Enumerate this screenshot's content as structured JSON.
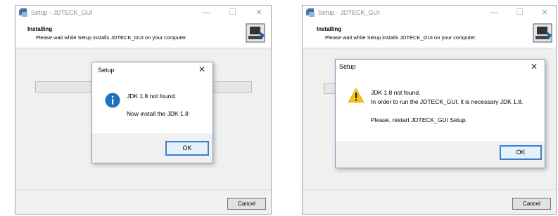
{
  "left_window": {
    "title": "Setup - JDTECK_GUI",
    "header_title": "Installing",
    "header_subtitle": "Please wait while Setup installs JDTECK_GUI on your computer.",
    "cancel_label": "Cancel",
    "dialog": {
      "title": "Setup",
      "line1": "JDK 1.8 not found.",
      "line2": "Now install the JDK 1.8",
      "ok_label": "OK",
      "icon": "info-icon"
    }
  },
  "right_window": {
    "title": "Setup - JDTECK_GUI",
    "header_title": "Installing",
    "header_subtitle": "Please wait while Setup installs JDTECK_GUI on your computer.",
    "cancel_label": "Cancel",
    "dialog": {
      "title": "Setup",
      "line1": "JDK 1.8 not found.",
      "line2": "In order to run the JDTECK_GUI, it is necessary JDK 1.8.",
      "line3": "Please, restart JDTECK_GUI Setup.",
      "ok_label": "OK",
      "icon": "warning-icon"
    }
  },
  "colors": {
    "accent": "#3c7fd0",
    "info_blue": "#1e73be",
    "warning_yellow": "#f5c518"
  }
}
